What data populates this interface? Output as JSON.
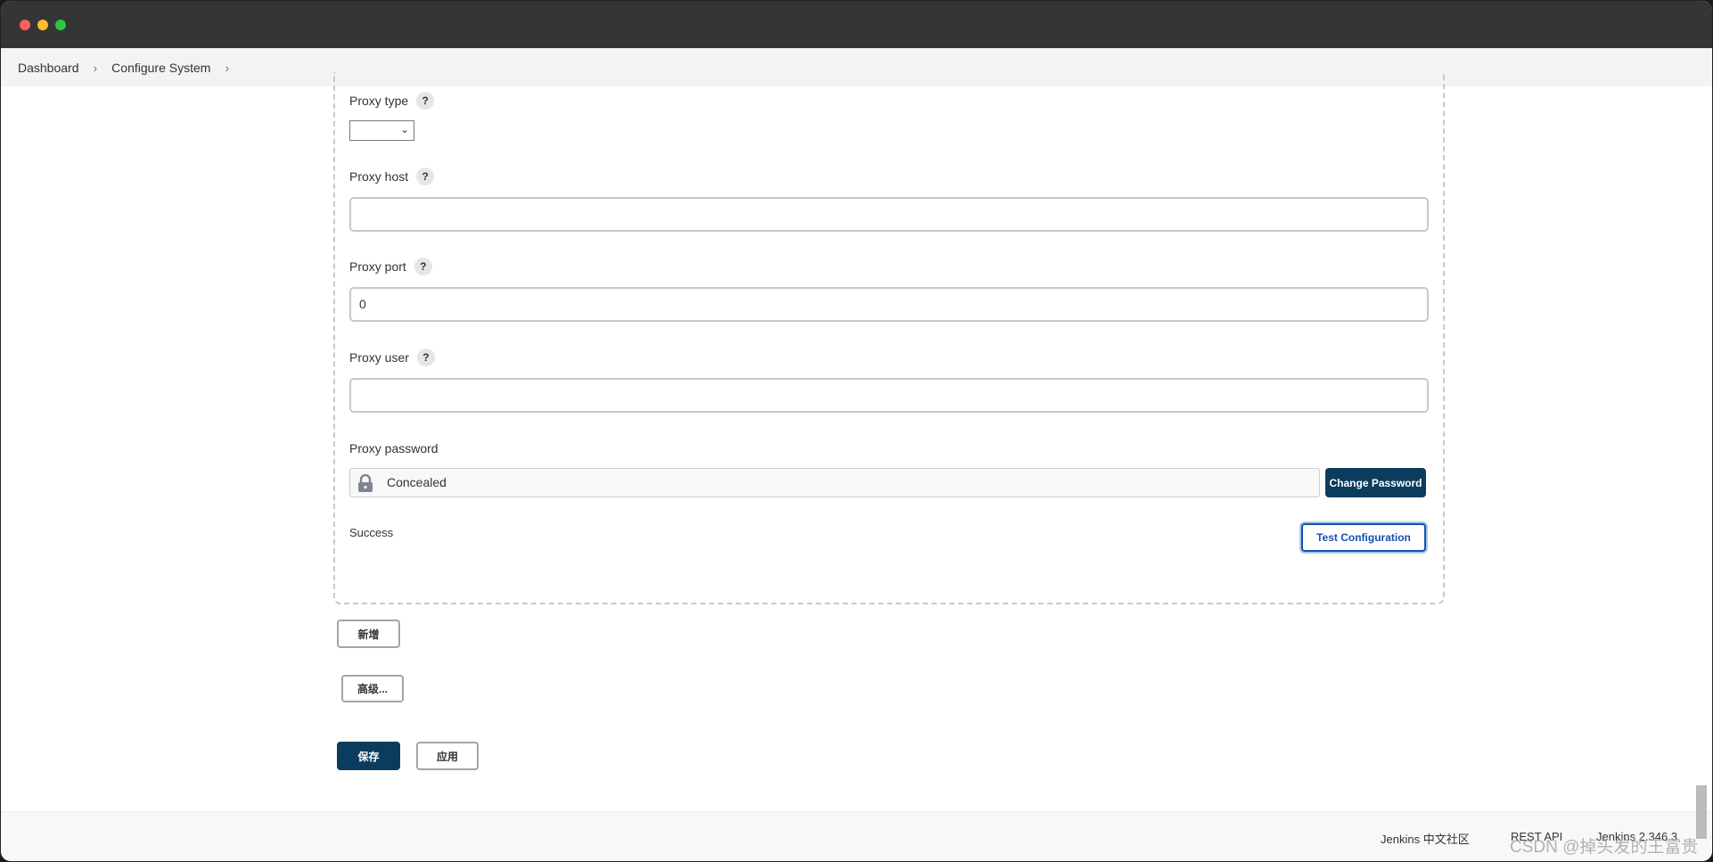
{
  "window": {
    "controls": {
      "close": "#fe5f57",
      "minimize": "#febc2e",
      "maximize": "#28c840"
    }
  },
  "breadcrumb": {
    "items": [
      "Dashboard",
      "Configure System"
    ]
  },
  "form": {
    "proxy_type": {
      "label": "Proxy type",
      "help": "?",
      "value": ""
    },
    "proxy_host": {
      "label": "Proxy host",
      "help": "?",
      "value": ""
    },
    "proxy_port": {
      "label": "Proxy port",
      "help": "?",
      "value": "0"
    },
    "proxy_user": {
      "label": "Proxy user",
      "help": "?",
      "value": ""
    },
    "proxy_password": {
      "label": "Proxy password",
      "value": "Concealed",
      "change_label": "Change Password"
    },
    "status": "Success",
    "test_label": "Test Configuration"
  },
  "buttons": {
    "add": "新增",
    "advanced": "高级...",
    "save": "保存",
    "apply": "应用"
  },
  "footer": {
    "community": "Jenkins 中文社区",
    "rest_api": "REST API",
    "version": "Jenkins 2.346.3"
  },
  "watermark": "CSDN @掉头发的王富贵",
  "colors": {
    "primary": "#0b3c5d",
    "link": "#1450b4"
  }
}
